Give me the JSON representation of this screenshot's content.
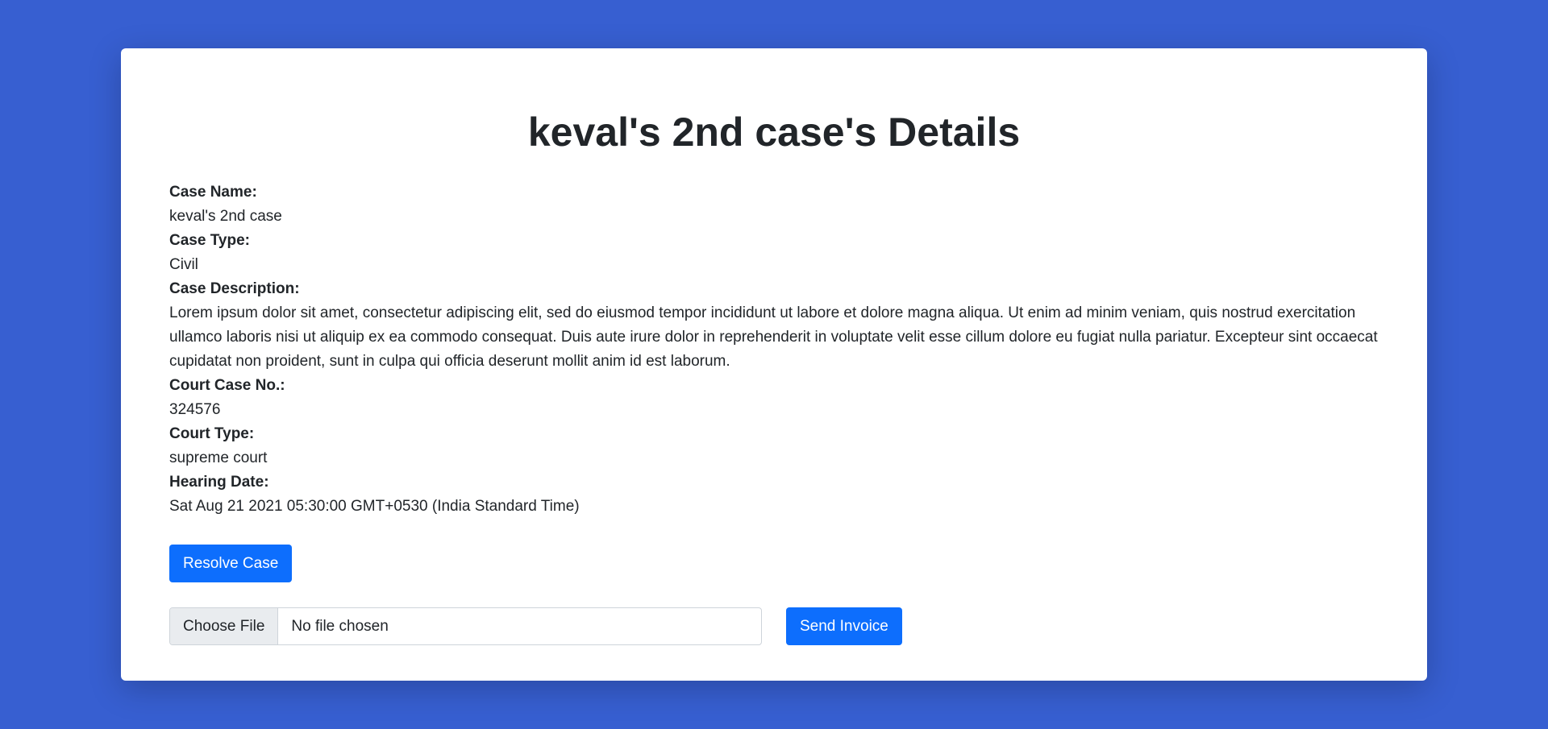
{
  "page": {
    "title": "keval's 2nd case's Details"
  },
  "fields": [
    {
      "label": "Case Name:",
      "value": "keval's 2nd case"
    },
    {
      "label": "Case Type:",
      "value": "Civil"
    },
    {
      "label": "Case Description:",
      "value": "Lorem ipsum dolor sit amet, consectetur adipiscing elit, sed do eiusmod tempor incididunt ut labore et dolore magna aliqua. Ut enim ad minim veniam, quis nostrud exercitation ullamco laboris nisi ut aliquip ex ea commodo consequat. Duis aute irure dolor in reprehenderit in voluptate velit esse cillum dolore eu fugiat nulla pariatur. Excepteur sint occaecat cupidatat non proident, sunt in culpa qui officia deserunt mollit anim id est laborum."
    },
    {
      "label": "Court Case No.:",
      "value": "324576"
    },
    {
      "label": "Court Type:",
      "value": "supreme court"
    },
    {
      "label": "Hearing Date:",
      "value": "Sat Aug 21 2021 05:30:00 GMT+0530 (India Standard Time)"
    }
  ],
  "actions": {
    "resolve_label": "Resolve Case",
    "choose_file_label": "Choose File",
    "file_status": "No file chosen",
    "send_invoice_label": "Send Invoice"
  },
  "colors": {
    "background": "#375fd1",
    "primary_button": "#0d6efd"
  }
}
